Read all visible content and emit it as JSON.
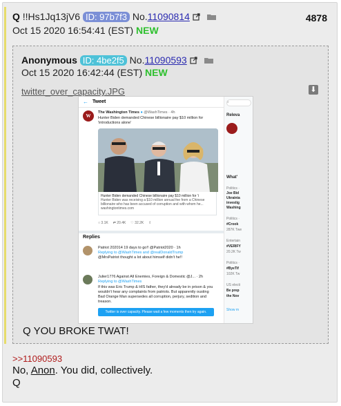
{
  "post": {
    "name": "Q",
    "tripcode": "!!Hs1Jq13jV6",
    "id_label": "ID: 97b7f3",
    "id_color": "#7b8fd6",
    "no_label": "No.",
    "number": "11090814",
    "date": "Oct 15 2020 16:54:41 (EST)",
    "new_badge": "NEW",
    "count": "4878"
  },
  "quoted": {
    "name": "Anonymous",
    "id_label": "ID: 4be2f5",
    "id_color": "#4ec2d8",
    "no_label": "No.",
    "number": "11090593",
    "date": "Oct 15 2020 16:42:44 (EST)",
    "new_badge": "NEW",
    "file_name": "twitter_over_capacity.JPG",
    "text": "Q YOU BROKE TWAT!"
  },
  "screenshot": {
    "top_title": "Tweet",
    "author": "The Washington Times",
    "handle": "@WashTimes · 4h",
    "tweet_text": "Hunter Biden demanded Chinese billionaire pay $10 million for",
    "tweet_text2": "'introductions alone'",
    "card_title": "Hunter Biden demanded Chinese billionaire pay $10 million for 'i",
    "card_desc": "Hunter Biden was receiving a $10 million annual fee from a Chinese billionaire who has been accused of corruption and with whom he...",
    "card_url": "washingtontimes.com",
    "actions": [
      "3.1K",
      "20.4K",
      "32.2K"
    ],
    "replies_header": "Replies",
    "reply1_name": "Patriot 202014 19 days to go!! @Patriot2020 · 1h",
    "reply1_to": "Replying to @WashTimes and @realDonaldTrump",
    "reply1_text": "@MrsPatriot thought a lot about himself didn't he!!",
    "reply2_name": "Julier1776 Against All Enemies, Foreign & Domestic @J... · 2h",
    "reply2_to": "Replying to @WashTimes",
    "reply2_text1": "If this was Eric Trump & HIS father, they'd already be in prison & you",
    "reply2_text2": "wouldn't hear any complaints from patriots. But apparently ousting",
    "reply2_text3": "Bad Orange Man supersedes all corruption, perjury, sedition and",
    "reply2_text4": "treason.",
    "toast": "Twitter is over capacity. Please wait a few moments then try again.",
    "side_relevant": "Releva",
    "side_whats": "What'",
    "side_items": [
      "Politics · ",
      "Joe Bid",
      "Ukrainia",
      "investig",
      "Washing",
      "Politics · ",
      "#Crook",
      "287K Twe",
      "Entertain",
      "#VERIFY",
      "20.2K Tw",
      "Politics · ",
      "#ByeTif",
      "102K Tw",
      "US electi",
      "Be prep",
      "the Nov",
      "Show m"
    ]
  },
  "reply": {
    "link": ">>11090593",
    "line1_pre": "No, ",
    "line1_anon": "Anon",
    "line1_post": ". You did, collectively.",
    "line2": "Q"
  }
}
